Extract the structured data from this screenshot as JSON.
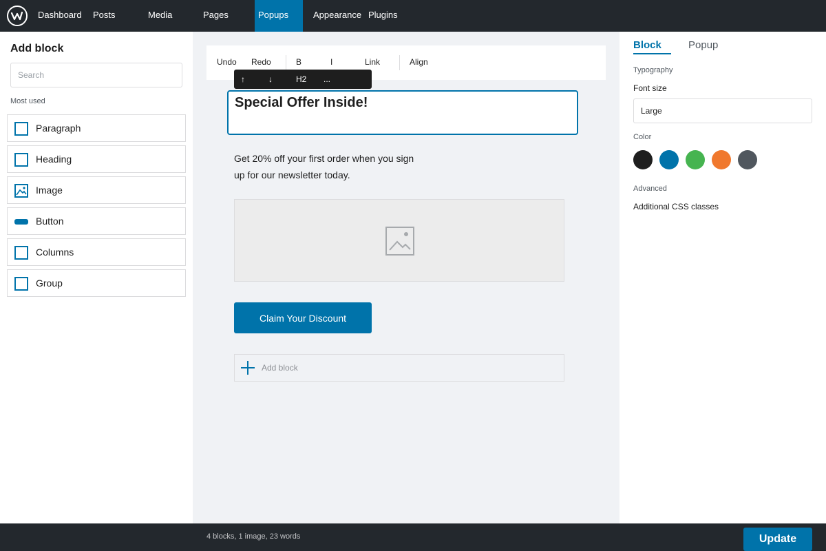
{
  "topbar": {
    "nav": [
      {
        "label": "Dashboard"
      },
      {
        "label": "Posts"
      },
      {
        "label": "Media"
      },
      {
        "label": "Pages"
      },
      {
        "label": "Popups",
        "active": true
      },
      {
        "label": "Appearance"
      },
      {
        "label": "Plugins"
      }
    ]
  },
  "left_panel": {
    "title": "Add block",
    "search_placeholder": "Search",
    "section_label": "Most used",
    "blocks": [
      {
        "label": "Paragraph",
        "icon": "square-outline-icon"
      },
      {
        "label": "Heading",
        "icon": "square-outline-icon"
      },
      {
        "label": "Image",
        "icon": "image-icon"
      },
      {
        "label": "Button",
        "icon": "button-pill-icon"
      },
      {
        "label": "Columns",
        "icon": "square-outline-icon"
      },
      {
        "label": "Group",
        "icon": "square-outline-icon"
      }
    ]
  },
  "toolbar": {
    "undo": "Undo",
    "redo": "Redo",
    "bold": "B",
    "italic": "I",
    "link": "Link",
    "align": "Align"
  },
  "block_toolbar": {
    "move_up": "↑",
    "move_down": "↓",
    "heading_level": "H2",
    "more": "..."
  },
  "canvas": {
    "heading": "Special Offer Inside!",
    "paragraph": "Get 20% off your first order when you sign up for our newsletter today.",
    "cta_label": "Claim Your Discount",
    "add_block_label": "Add block"
  },
  "right_panel": {
    "tabs": [
      {
        "label": "Block",
        "active": true
      },
      {
        "label": "Popup",
        "active": false
      }
    ],
    "typography_label": "Typography",
    "font_size_label": "Font size",
    "font_size_value": "Large",
    "color_label": "Color",
    "colors": [
      "#1e1e1e",
      "#0073aa",
      "#46b450",
      "#f0782d",
      "#50575e"
    ],
    "advanced_label": "Advanced",
    "css_classes_label": "Additional CSS classes"
  },
  "status": {
    "summary": "4 blocks, 1 image, 23 words",
    "update_label": "Update"
  },
  "theme": {
    "accent": "#0073aa",
    "admin_bar": "#23282d"
  }
}
